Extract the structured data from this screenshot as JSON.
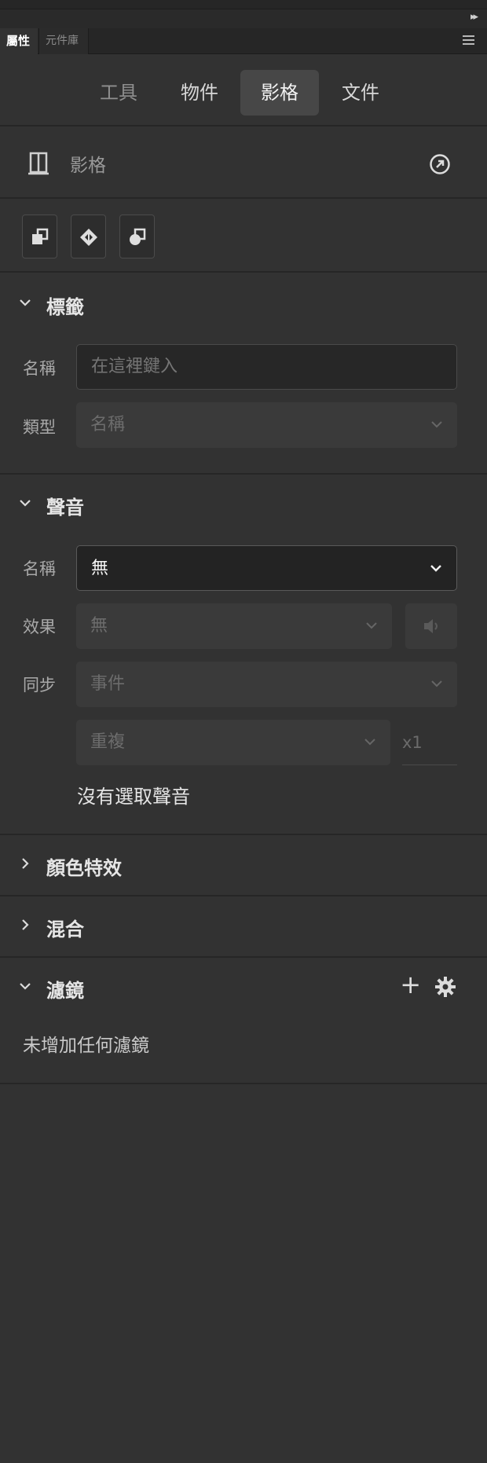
{
  "panel": {
    "tabs": {
      "active": "屬性",
      "inactive": "元件庫"
    }
  },
  "segments": [
    "工具",
    "物件",
    "影格",
    "文件"
  ],
  "frame": {
    "label": "影格"
  },
  "labels_section": {
    "title": "標籤",
    "name_label": "名稱",
    "name_placeholder": "在這裡鍵入",
    "type_label": "類型",
    "type_value": "名稱"
  },
  "sound_section": {
    "title": "聲音",
    "name_label": "名稱",
    "name_value": "無",
    "effect_label": "效果",
    "effect_value": "無",
    "sync_label": "同步",
    "sync_value": "事件",
    "repeat_value": "重複",
    "repeat_count": "x1",
    "no_sound_text": "沒有選取聲音"
  },
  "color_effect_section": {
    "title": "顏色特效"
  },
  "blend_section": {
    "title": "混合"
  },
  "filters_section": {
    "title": "濾鏡",
    "add_symbol": "+",
    "empty_text": "未增加任何濾鏡"
  },
  "colors": {
    "panel_bg": "#323232",
    "selected_tab_bg": "#474747",
    "divider": "#262626"
  }
}
